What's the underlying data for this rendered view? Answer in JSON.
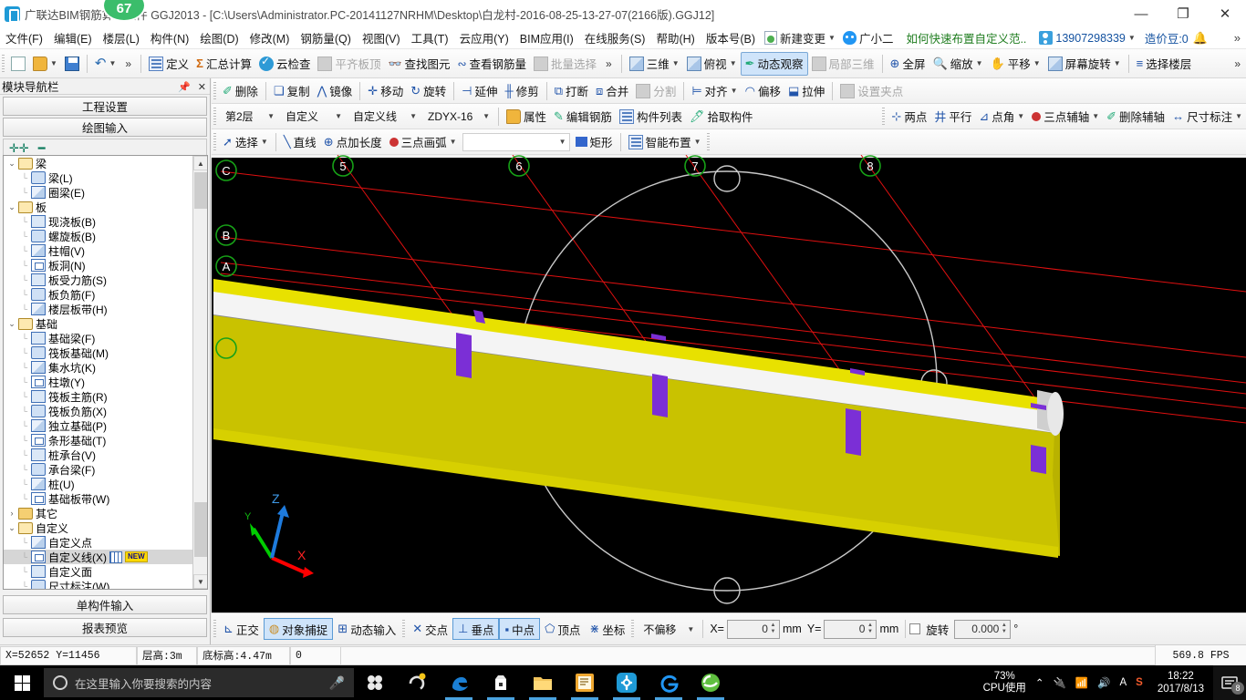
{
  "titlebar": {
    "app_title": "广联达BIM钢筋算量软件 GGJ2013 - [C:\\Users\\Administrator.PC-20141127NRHM\\Desktop\\白龙村-2016-08-25-13-27-07(2166版).GGJ12]",
    "badge": "67",
    "minimize": "—",
    "maximize": "❐",
    "close": "✕"
  },
  "menubar": {
    "items": [
      {
        "label": "文件(F)"
      },
      {
        "label": "编辑(E)"
      },
      {
        "label": "楼层(L)"
      },
      {
        "label": "构件(N)"
      },
      {
        "label": "绘图(D)"
      },
      {
        "label": "修改(M)"
      },
      {
        "label": "钢筋量(Q)"
      },
      {
        "label": "视图(V)"
      },
      {
        "label": "工具(T)"
      },
      {
        "label": "云应用(Y)"
      },
      {
        "label": "BIM应用(I)"
      },
      {
        "label": "在线服务(S)"
      },
      {
        "label": "帮助(H)"
      },
      {
        "label": "版本号(B)"
      }
    ],
    "new_change": "新建变更",
    "user_nick": "广小二",
    "tip": "如何快速布置自定义范..",
    "phone": "13907298339",
    "coins": "造价豆:0",
    "overflow": "»"
  },
  "toolbar_main": {
    "file_group": [
      {
        "label": "",
        "name": "new-file",
        "icon": "doc-icon"
      },
      {
        "label": "",
        "name": "open-file",
        "icon": "folder-open-icon"
      },
      {
        "label": "",
        "name": "save-file",
        "icon": "save-icon"
      },
      {
        "label": "",
        "name": "undo",
        "icon": "undo-icon"
      }
    ],
    "items": [
      {
        "label": "定义",
        "icon": "define-icon",
        "disabled": false
      },
      {
        "label": "汇总计算",
        "icon": "sigma-icon",
        "disabled": false
      },
      {
        "label": "云检查",
        "icon": "cloud-check-icon",
        "disabled": false
      },
      {
        "label": "平齐板顶",
        "icon": "align-slab-icon",
        "disabled": true
      },
      {
        "label": "查找图元",
        "icon": "binoculars-icon",
        "disabled": false
      },
      {
        "label": "查看钢筋量",
        "icon": "rebar-view-icon",
        "disabled": false
      },
      {
        "label": "批量选择",
        "icon": "batch-select-icon",
        "disabled": true
      }
    ],
    "view_items": [
      {
        "label": "三维",
        "icon": "cube-icon",
        "dropdown": true,
        "disabled": false
      },
      {
        "label": "俯视",
        "icon": "topview-icon",
        "dropdown": true,
        "disabled": false
      },
      {
        "label": "动态观察",
        "icon": "orbit-icon",
        "dropdown": false,
        "active": true,
        "disabled": false
      },
      {
        "label": "局部三维",
        "icon": "local3d-icon",
        "dropdown": false,
        "disabled": true
      },
      {
        "label": "全屏",
        "icon": "fullscreen-icon",
        "dropdown": false,
        "disabled": false
      },
      {
        "label": "缩放",
        "icon": "zoom-icon",
        "dropdown": true,
        "disabled": false
      },
      {
        "label": "平移",
        "icon": "pan-icon",
        "dropdown": true,
        "disabled": false
      },
      {
        "label": "屏幕旋转",
        "icon": "screen-rotate-icon",
        "dropdown": true,
        "disabled": false
      },
      {
        "label": "选择楼层",
        "icon": "select-floor-icon",
        "dropdown": false,
        "disabled": false
      }
    ],
    "overflow": "»"
  },
  "toolbar_edit": {
    "items": [
      {
        "label": "删除",
        "icon": "delete-icon",
        "disabled": false
      },
      {
        "label": "复制",
        "icon": "copy-icon",
        "disabled": false
      },
      {
        "label": "镜像",
        "icon": "mirror-icon",
        "disabled": false
      },
      {
        "label": "移动",
        "icon": "move-icon",
        "disabled": false
      },
      {
        "label": "旋转",
        "icon": "rotate-icon",
        "disabled": false
      },
      {
        "label": "延伸",
        "icon": "extend-icon",
        "disabled": false
      },
      {
        "label": "修剪",
        "icon": "trim-icon",
        "disabled": false
      },
      {
        "label": "打断",
        "icon": "break-icon",
        "disabled": false
      },
      {
        "label": "合并",
        "icon": "merge-icon",
        "disabled": false
      },
      {
        "label": "分割",
        "icon": "split-icon",
        "disabled": true
      },
      {
        "label": "对齐",
        "icon": "align-icon",
        "dropdown": true,
        "disabled": false
      },
      {
        "label": "偏移",
        "icon": "offset-icon",
        "disabled": false
      },
      {
        "label": "拉伸",
        "icon": "stretch-icon",
        "disabled": false
      },
      {
        "label": "设置夹点",
        "icon": "grip-point-icon",
        "disabled": true
      }
    ]
  },
  "toolbar_component": {
    "floor_select": "第2层",
    "category_select": "自定义",
    "type_select": "自定义线",
    "member_select": "ZDYX-16",
    "buttons": [
      {
        "label": "属性",
        "icon": "properties-icon"
      },
      {
        "label": "编辑钢筋",
        "icon": "edit-rebar-icon"
      },
      {
        "label": "构件列表",
        "icon": "component-list-icon"
      },
      {
        "label": "拾取构件",
        "icon": "pick-component-icon"
      }
    ],
    "axis_buttons": [
      {
        "label": "两点",
        "icon": "two-point-icon",
        "dropdown": false
      },
      {
        "label": "平行",
        "icon": "parallel-icon",
        "dropdown": false
      },
      {
        "label": "点角",
        "icon": "point-angle-icon",
        "dropdown": true
      },
      {
        "label": "三点辅轴",
        "icon": "three-point-axis-icon",
        "dropdown": true
      },
      {
        "label": "删除辅轴",
        "icon": "delete-axis-icon",
        "dropdown": false
      },
      {
        "label": "尺寸标注",
        "icon": "dimension-icon",
        "dropdown": true
      }
    ]
  },
  "toolbar_draw": {
    "items": [
      {
        "label": "选择",
        "icon": "cursor-icon",
        "dropdown": true
      },
      {
        "label": "直线",
        "icon": "line-icon",
        "dropdown": false
      },
      {
        "label": "点加长度",
        "icon": "point-length-icon",
        "dropdown": false
      },
      {
        "label": "三点画弧",
        "icon": "three-point-arc-icon",
        "dropdown": true
      }
    ],
    "empty_combo": "",
    "rect_label": "矩形",
    "smart_label": "智能布置"
  },
  "sidebar": {
    "panel_title": "模块导航栏",
    "pin_icon": "pin-icon",
    "close_icon": "close-icon",
    "top_buttons": [
      {
        "label": "工程设置"
      },
      {
        "label": "绘图输入"
      }
    ],
    "bottom_buttons": [
      {
        "label": "单构件输入"
      },
      {
        "label": "报表预览"
      }
    ],
    "tree": [
      {
        "level": 0,
        "type": "folder",
        "label": "梁",
        "expanded": true
      },
      {
        "level": 1,
        "type": "leaf",
        "label": "梁(L)",
        "icon": "beam-icon"
      },
      {
        "level": 1,
        "type": "leaf",
        "label": "圈梁(E)",
        "icon": "ring-beam-icon"
      },
      {
        "level": 0,
        "type": "folder",
        "label": "板",
        "expanded": true
      },
      {
        "level": 1,
        "type": "leaf",
        "label": "现浇板(B)",
        "icon": "slab-icon"
      },
      {
        "level": 1,
        "type": "leaf",
        "label": "螺旋板(B)",
        "icon": "spiral-slab-icon"
      },
      {
        "level": 1,
        "type": "leaf",
        "label": "柱帽(V)",
        "icon": "column-cap-icon"
      },
      {
        "level": 1,
        "type": "leaf",
        "label": "板洞(N)",
        "icon": "slab-hole-icon"
      },
      {
        "level": 1,
        "type": "leaf",
        "label": "板受力筋(S)",
        "icon": "slab-rebar-icon"
      },
      {
        "level": 1,
        "type": "leaf",
        "label": "板负筋(F)",
        "icon": "slab-negative-rebar-icon"
      },
      {
        "level": 1,
        "type": "leaf",
        "label": "楼层板带(H)",
        "icon": "floor-band-icon"
      },
      {
        "level": 0,
        "type": "folder",
        "label": "基础",
        "expanded": true
      },
      {
        "level": 1,
        "type": "leaf",
        "label": "基础梁(F)",
        "icon": "foundation-beam-icon"
      },
      {
        "level": 1,
        "type": "leaf",
        "label": "筏板基础(M)",
        "icon": "raft-foundation-icon"
      },
      {
        "level": 1,
        "type": "leaf",
        "label": "集水坑(K)",
        "icon": "sump-icon"
      },
      {
        "level": 1,
        "type": "leaf",
        "label": "柱墩(Y)",
        "icon": "column-pier-icon"
      },
      {
        "level": 1,
        "type": "leaf",
        "label": "筏板主筋(R)",
        "icon": "raft-main-rebar-icon"
      },
      {
        "level": 1,
        "type": "leaf",
        "label": "筏板负筋(X)",
        "icon": "raft-negative-rebar-icon"
      },
      {
        "level": 1,
        "type": "leaf",
        "label": "独立基础(P)",
        "icon": "isolated-foundation-icon"
      },
      {
        "level": 1,
        "type": "leaf",
        "label": "条形基础(T)",
        "icon": "strip-foundation-icon"
      },
      {
        "level": 1,
        "type": "leaf",
        "label": "桩承台(V)",
        "icon": "pile-cap-icon"
      },
      {
        "level": 1,
        "type": "leaf",
        "label": "承台梁(F)",
        "icon": "cap-beam-icon"
      },
      {
        "level": 1,
        "type": "leaf",
        "label": "桩(U)",
        "icon": "pile-icon"
      },
      {
        "level": 1,
        "type": "leaf",
        "label": "基础板带(W)",
        "icon": "foundation-band-icon"
      },
      {
        "level": 0,
        "type": "folder",
        "label": "其它",
        "expanded": false
      },
      {
        "level": 0,
        "type": "folder",
        "label": "自定义",
        "expanded": true
      },
      {
        "level": 1,
        "type": "leaf",
        "label": "自定义点",
        "icon": "custom-point-icon"
      },
      {
        "level": 1,
        "type": "leaf",
        "label": "自定义线(X)",
        "icon": "custom-line-icon",
        "selected": true,
        "badge": "NEW"
      },
      {
        "level": 1,
        "type": "leaf",
        "label": "自定义面",
        "icon": "custom-face-icon"
      },
      {
        "level": 1,
        "type": "leaf",
        "label": "尺寸标注(W)",
        "icon": "dimension-note-icon"
      }
    ]
  },
  "viewport": {
    "grid_labels_letters": [
      "C",
      "B",
      "A"
    ],
    "grid_labels_numbers": [
      "5",
      "6",
      "7",
      "8"
    ],
    "axis_labels": {
      "x": "X",
      "y": "Y",
      "z": "Z"
    }
  },
  "status": {
    "snap_buttons": [
      {
        "label": "正交",
        "icon": "ortho-icon",
        "on": false
      },
      {
        "label": "对象捕捉",
        "icon": "object-snap-icon",
        "on": true
      },
      {
        "label": "动态输入",
        "icon": "dynamic-input-icon",
        "on": false
      }
    ],
    "snap_modes": [
      {
        "label": "交点",
        "icon": "intersection-icon",
        "on": false
      },
      {
        "label": "垂点",
        "icon": "perpendicular-icon",
        "on": true
      },
      {
        "label": "中点",
        "icon": "midpoint-icon",
        "on": true
      },
      {
        "label": "顶点",
        "icon": "vertex-icon",
        "on": false
      },
      {
        "label": "坐标",
        "icon": "coordinate-icon",
        "on": false
      }
    ],
    "offset_select": "不偏移",
    "x_label": "X=",
    "x_value": "0",
    "x_unit": "mm",
    "y_label": "Y=",
    "y_value": "0",
    "y_unit": "mm",
    "rotate_label": "旋转",
    "rotate_value": "0.000",
    "rotate_unit": "°"
  },
  "bottombar": {
    "coords": "X=52652  Y=11456",
    "floor_height": "层高:3m",
    "base_elevation": "底标高:4.47m",
    "extra": "0",
    "fps": "569.8 FPS"
  },
  "taskbar": {
    "search_placeholder": "在这里输入你要搜索的内容",
    "apps": [
      {
        "name": "sogou-pinyin-icon"
      },
      {
        "name": "360-browser-icon"
      },
      {
        "name": "edge-icon"
      },
      {
        "name": "microsoft-store-icon"
      },
      {
        "name": "file-explorer-icon"
      },
      {
        "name": "notes-app-icon"
      },
      {
        "name": "glodon-app-icon"
      },
      {
        "name": "browser-g-icon"
      },
      {
        "name": "ie-green-icon"
      }
    ],
    "cpu_percent": "73%",
    "cpu_label": "CPU使用",
    "time": "18:22",
    "date": "2017/8/13",
    "notification_count": "8"
  }
}
